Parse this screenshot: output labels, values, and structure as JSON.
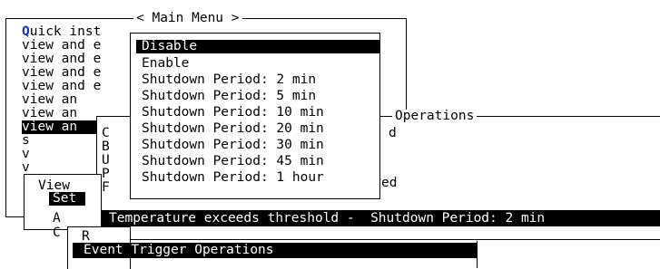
{
  "main_menu": {
    "title": "< Main Menu >",
    "first_item_hotkey": "Q",
    "first_item_rest": "uick inst",
    "items": [
      "view and e",
      "view and e",
      "view and e",
      "view and e",
      "view an",
      "view an",
      "view an",
      "s",
      "v",
      "v"
    ]
  },
  "view_submenu": {
    "items": [
      "View",
      "Set",
      "A",
      "C"
    ]
  },
  "r_box": {
    "label": "R"
  },
  "ops_window": {
    "title": "Operations",
    "col_letters": [
      "C",
      "B",
      "U",
      "P",
      "F"
    ],
    "right_fragments": [
      "d",
      "ed"
    ]
  },
  "shutdown_popup": {
    "items": [
      "Disable",
      "Enable",
      "Shutdown Period: 2 min",
      "Shutdown Period: 5 min",
      "Shutdown Period: 10 min",
      "Shutdown Period: 20 min",
      "Shutdown Period: 30 min",
      "Shutdown Period: 45 min",
      "Shutdown Period: 1 hour"
    ],
    "selected_index": 0
  },
  "temperature_bar": {
    "text": "Temperature exceeds threshold -  Shutdown Period: 2 min"
  },
  "event_trigger_bar": {
    "text": "Event Trigger Operations"
  },
  "colors": {
    "background": "#ffffff",
    "foreground": "#000000",
    "hotkey": "#1a2fb0"
  }
}
